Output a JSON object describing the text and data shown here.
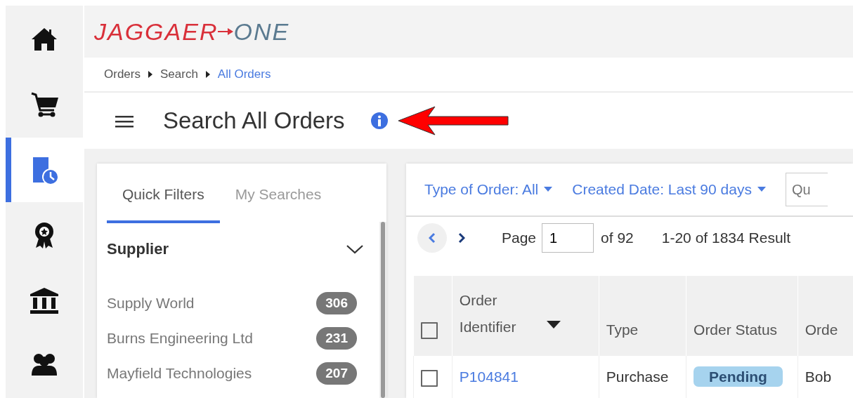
{
  "nav_rail": [
    {
      "kind": "home",
      "selected": false
    },
    {
      "kind": "cart",
      "selected": false
    },
    {
      "kind": "document-clock",
      "selected": true
    },
    {
      "kind": "award",
      "selected": false
    },
    {
      "kind": "bank",
      "selected": false
    },
    {
      "kind": "users",
      "selected": false
    }
  ],
  "logo": {
    "primary": "JAGGAER",
    "secondary": "ONE"
  },
  "breadcrumb": [
    {
      "label": "Orders",
      "current": false
    },
    {
      "label": "Search",
      "current": false
    },
    {
      "label": "All Orders",
      "current": true
    }
  ],
  "page_title": "Search All Orders",
  "filter_panel": {
    "tabs": [
      {
        "label": "Quick Filters",
        "selected": true
      },
      {
        "label": "My Searches",
        "selected": false
      }
    ],
    "section": "Supplier",
    "items": [
      {
        "name": "Supply World",
        "count": "306"
      },
      {
        "name": "Burns Engineering Ltd",
        "count": "231"
      },
      {
        "name": "Mayfield Technologies",
        "count": "207"
      }
    ]
  },
  "results": {
    "filters": [
      "Type of Order: All",
      "Created Date: Last 90 days"
    ],
    "search": {
      "placeholder": "Qu"
    },
    "pagination": {
      "page_label": "Page",
      "page": "1",
      "of": "of 92",
      "summary": "1-20 of 1834 Result"
    },
    "table": {
      "select_all_checked": false,
      "columns": [
        {
          "label": "Order Identifier",
          "sorted": true
        },
        {
          "label": "Type",
          "sorted": false
        },
        {
          "label": "Order Status",
          "sorted": false
        },
        {
          "label": "Orde",
          "sorted": false
        }
      ],
      "rows": [
        {
          "checked": false,
          "cells": [
            "P104841",
            "Purchase",
            "Pending",
            "Bob"
          ]
        }
      ]
    }
  }
}
